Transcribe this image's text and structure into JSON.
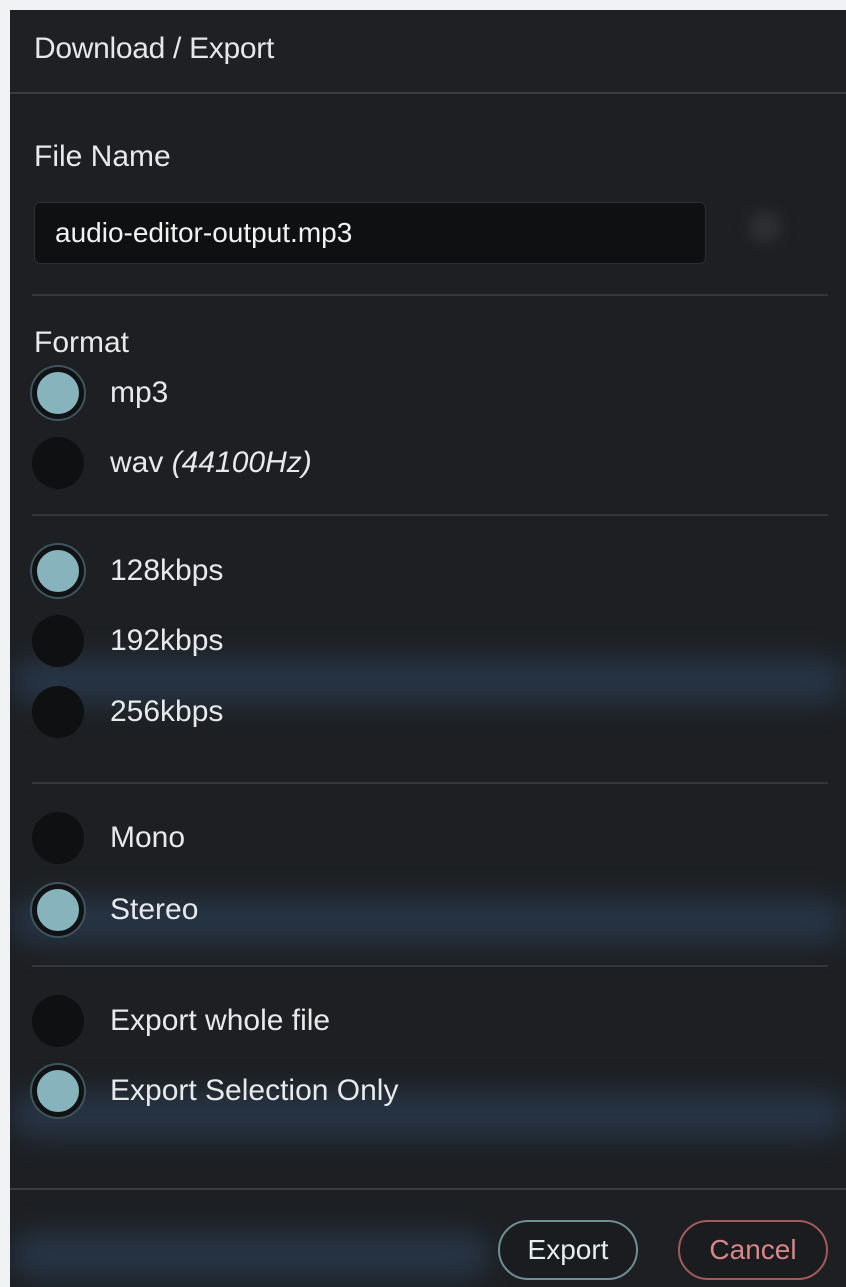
{
  "dialog": {
    "title": "Download / Export"
  },
  "file_name": {
    "label": "File Name",
    "value": "audio-editor-output.mp3"
  },
  "format": {
    "label": "Format",
    "options": [
      {
        "label": "mp3",
        "suffix": "",
        "checked": true
      },
      {
        "label": "wav ",
        "suffix": "(44100Hz)",
        "checked": false
      }
    ]
  },
  "bitrate": {
    "options": [
      {
        "label": "128kbps",
        "checked": true
      },
      {
        "label": "192kbps",
        "checked": false
      },
      {
        "label": "256kbps",
        "checked": false
      }
    ]
  },
  "channels": {
    "options": [
      {
        "label": "Mono",
        "checked": false
      },
      {
        "label": "Stereo",
        "checked": true
      }
    ]
  },
  "range": {
    "options": [
      {
        "label": "Export whole file",
        "checked": false
      },
      {
        "label": "Export Selection Only",
        "checked": true
      }
    ]
  },
  "footer": {
    "export_label": "Export",
    "cancel_label": "Cancel"
  },
  "colors": {
    "dialog_bg": "#1d1f22",
    "radio_checked": "#86b3bc",
    "export_border": "#6f8f96",
    "cancel_border": "#a35a5a",
    "cancel_text": "#d98686"
  }
}
